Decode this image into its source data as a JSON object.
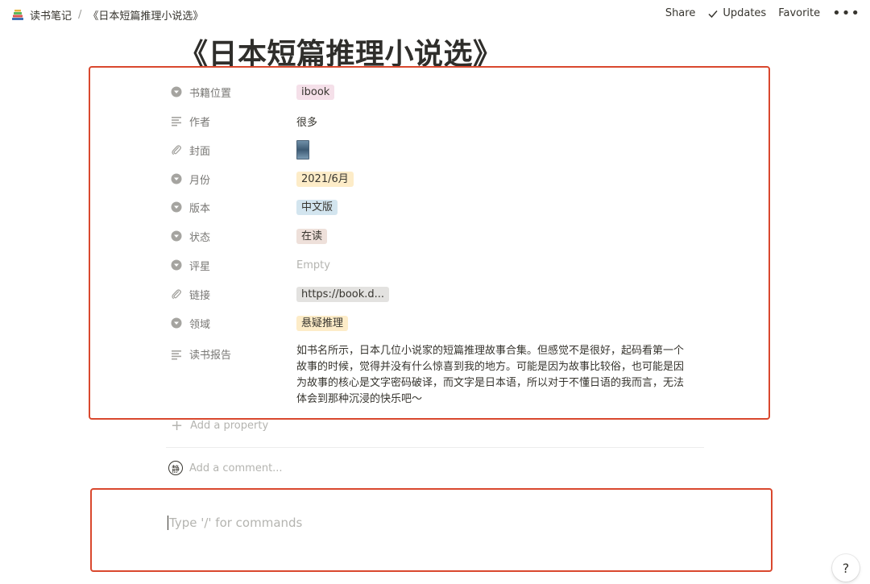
{
  "breadcrumb": {
    "workspace": "读书笔记",
    "separator": "/",
    "page": "《日本短篇推理小说选》"
  },
  "topbar": {
    "share": "Share",
    "updates": "Updates",
    "favorite": "Favorite",
    "more": "•••"
  },
  "title": "《日本短篇推理小说选》",
  "properties": [
    {
      "name": "书籍位置",
      "icon": "select-icon",
      "value": "ibook",
      "tag_bg": "#f5e0e9"
    },
    {
      "name": "作者",
      "icon": "text-icon",
      "value": "很多"
    },
    {
      "name": "封面",
      "icon": "attachment-icon",
      "value": ""
    },
    {
      "name": "月份",
      "icon": "select-icon",
      "value": "2021/6月",
      "tag_bg": "#fdecc8"
    },
    {
      "name": "版本",
      "icon": "select-icon",
      "value": "中文版",
      "tag_bg": "#d3e5ef"
    },
    {
      "name": "状态",
      "icon": "select-icon",
      "value": "在读",
      "tag_bg": "#eee0da"
    },
    {
      "name": "评星",
      "icon": "select-icon",
      "value": "Empty"
    },
    {
      "name": "链接",
      "icon": "attachment-icon",
      "value": "https://book.d...",
      "tag_bg": "#e3e2e0"
    },
    {
      "name": "领域",
      "icon": "select-icon",
      "value": "悬疑推理",
      "tag_bg": "#fdecc8"
    },
    {
      "name": "读书报告",
      "icon": "text-icon",
      "value": "如书名所示，日本几位小说家的短篇推理故事合集。但感觉不是很好，起码看第一个故事的时候，觉得并没有什么惊喜到我的地方。可能是因为故事比较俗，也可能是因为故事的核心是文字密码破译，而文字是日本语，所以对于不懂日语的我而言，无法体会到那种沉浸的快乐吧～"
    }
  ],
  "add_property": "Add a property",
  "comment": {
    "avatar": "静",
    "placeholder": "Add a comment..."
  },
  "editor": {
    "placeholder": "Type '/' for commands"
  },
  "help": "?",
  "colors": {
    "highlight_border": "#d9482e",
    "text": "#37352f",
    "muted": "#787774"
  }
}
